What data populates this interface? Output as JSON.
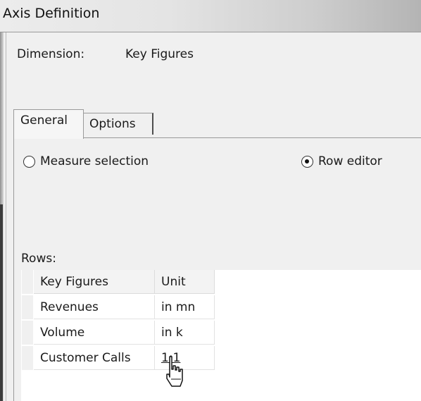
{
  "window": {
    "title": "Axis Definition"
  },
  "dimension": {
    "label": "Dimension:",
    "value": "Key Figures"
  },
  "tabs": [
    {
      "label": "General",
      "active": true
    },
    {
      "label": "Options",
      "active": false
    }
  ],
  "selection_mode": {
    "options": [
      {
        "label": "Measure selection",
        "checked": false
      },
      {
        "label": "Row editor",
        "checked": true
      }
    ]
  },
  "rows": {
    "label": "Rows:",
    "columns": [
      "Key Figures",
      "Unit"
    ],
    "items": [
      {
        "key_figure": "Revenues",
        "unit": "in mn"
      },
      {
        "key_figure": "Volume",
        "unit": "in k"
      },
      {
        "key_figure": "Customer Calls",
        "unit": "1:1"
      }
    ]
  },
  "icons": {
    "cursor": "hand-pointer-icon"
  }
}
